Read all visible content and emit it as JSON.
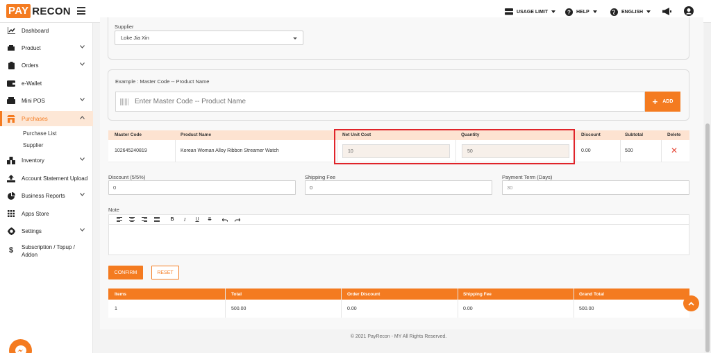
{
  "brand": {
    "box": "PAY",
    "rest": "RECON",
    "accent": "#f47b20"
  },
  "topnav": {
    "usage": "USAGE LIMIT",
    "help": "HELP",
    "language": "ENGLISH"
  },
  "sidebar": {
    "items": [
      {
        "label": "Dashboard",
        "icon": "chart-line-icon"
      },
      {
        "label": "Product",
        "icon": "box-icon"
      },
      {
        "label": "Orders",
        "icon": "clipboard-icon"
      },
      {
        "label": "e-Wallet",
        "icon": "wallet-icon"
      },
      {
        "label": "Mini POS",
        "icon": "pos-icon"
      },
      {
        "label": "Purchases",
        "icon": "store-icon"
      },
      {
        "label": "Inventory",
        "icon": "warehouse-icon"
      },
      {
        "label": "Account Statement Upload",
        "icon": "upload-icon"
      },
      {
        "label": "Business Reports",
        "icon": "pie-chart-icon"
      },
      {
        "label": "Apps Store",
        "icon": "grid-icon"
      },
      {
        "label": "Settings",
        "icon": "gear-icon"
      },
      {
        "label": "Subscription / Topup / Addon",
        "icon": "dollar-icon"
      }
    ],
    "sub": [
      "Purchase List",
      "Supplier"
    ]
  },
  "form": {
    "supplier_label": "Supplier",
    "supplier_value": "Loke Jia Xin",
    "example_label": "Example : Master Code -- Product Name",
    "search_placeholder": "Enter Master Code -- Product Name",
    "add_label": "ADD"
  },
  "items_table": {
    "headers": [
      "Master Code",
      "Product Name",
      "Net Unit Cost",
      "Quantity",
      "Discount",
      "Subtotal",
      "Delete"
    ],
    "rows": [
      {
        "master_code": "102645240819",
        "product_name": "Korean Woman Alloy Ribbon Streamer Watch",
        "net_unit_cost": "10",
        "quantity": "50",
        "discount": "0.00",
        "subtotal": "500"
      }
    ]
  },
  "extras": {
    "discount_label": "Discount (5/5%)",
    "discount_value": "0",
    "shipping_label": "Shipping Fee",
    "shipping_value": "0",
    "payment_label": "Payment Term (Days)",
    "payment_placeholder": "30",
    "note_label": "Note"
  },
  "buttons": {
    "confirm": "CONFIRM",
    "reset": "RESET"
  },
  "summary": {
    "headers": [
      "Items",
      "Total",
      "Order Discount",
      "Shipping Fee",
      "Grand Total"
    ],
    "values": [
      "1",
      "500.00",
      "0.00",
      "0.00",
      "500.00"
    ]
  },
  "footer": "© 2021 PayRecon - MY All Rights Reserved."
}
